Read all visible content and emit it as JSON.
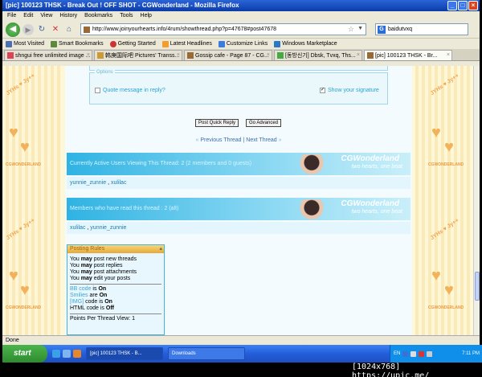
{
  "window": {
    "title": "[pic] 100123 THSK - Break Out ! OFF SHOT - CGWonderland - Mozilla Firefox",
    "buttons": [
      "_",
      "□",
      "×"
    ]
  },
  "menu": [
    "File",
    "Edit",
    "View",
    "History",
    "Bookmarks",
    "Tools",
    "Help"
  ],
  "nav": {
    "url": "http://www.joinyourhearts.info/4rum/showthread.php?p=47678#post47678",
    "search_value": "baidutvxq"
  },
  "bookmarks": [
    {
      "label": "Most Visited",
      "color": "#4a6fb5"
    },
    {
      "label": "Smart Bookmarks",
      "color": "#5a8a3a"
    },
    {
      "label": "Getting Started",
      "color": "#c33"
    },
    {
      "label": "Latest Headlines",
      "color": "#f39c2f"
    },
    {
      "label": "Customize Links",
      "color": "#3c7be0"
    },
    {
      "label": "Windows Marketplace",
      "color": "#2a79c9"
    }
  ],
  "tabs": [
    {
      "label": "shngui free unlimited image ..."
    },
    {
      "label": "韩庚国际吧 Pictures' Transs..."
    },
    {
      "label": "Gossip cafe - Page 87 - CG..."
    },
    {
      "label": "[동방신기] Dbsk, Tvxq, Ths..."
    },
    {
      "label": "[pic] 100123 THSK - Br..."
    }
  ],
  "options": {
    "legend": "Options",
    "quote_label": "Quote message in reply?",
    "signature_label": "Show your signature"
  },
  "buttons": {
    "post_quick_reply": "Post Quick Reply",
    "go_advanced": "Go Advanced"
  },
  "pager": {
    "prev_arrow": "«",
    "previous": "Previous Thread",
    "sep": "|",
    "next": "Next Thread",
    "next_arrow": "»"
  },
  "banners": {
    "logo": "CGWonderland",
    "tagline": "two hearts, one beat",
    "viewing_title": "Currently Active Users Viewing This Thread: 2 (2 members and 0 guests)",
    "read_title": "Members who have read this thread : 2 (alt)"
  },
  "viewing_users": [
    "yunnie_zunnie",
    "xulilac"
  ],
  "read_users": [
    "xulilac",
    "yunnie_zunnie"
  ],
  "posting_rules": {
    "title": "Posting Rules",
    "line1_a": "You",
    "line1_b": "may",
    "line1_c": "post new threads",
    "line2_a": "You",
    "line2_b": "may",
    "line2_c": "post replies",
    "line3_a": "You",
    "line3_b": "may",
    "line3_c": "post attachments",
    "line4_a": "You",
    "line4_b": "may",
    "line4_c": "edit your posts",
    "bb_a": "BB code",
    "bb_b": "is",
    "bb_c": "On",
    "smilies_a": "Smilies",
    "smilies_b": "are",
    "smilies_c": "On",
    "img_a": "[IMG]",
    "img_b": "code is",
    "img_c": "On",
    "html_a": "HTML code is",
    "html_c": "Off",
    "ppv": "Points Per Thread View: 1"
  },
  "deco": {
    "side_text": "JYHs ♥ Jy++",
    "cg_label": "CGWONDERLAND"
  },
  "status": "Done",
  "taskbar": {
    "start": "start",
    "tasks": [
      "[pic] 100123 THSK - B...",
      "Downloads"
    ],
    "lang": "EN",
    "clock": "7:11 PM"
  },
  "watermark": "[1024x768] https://upic.me/"
}
